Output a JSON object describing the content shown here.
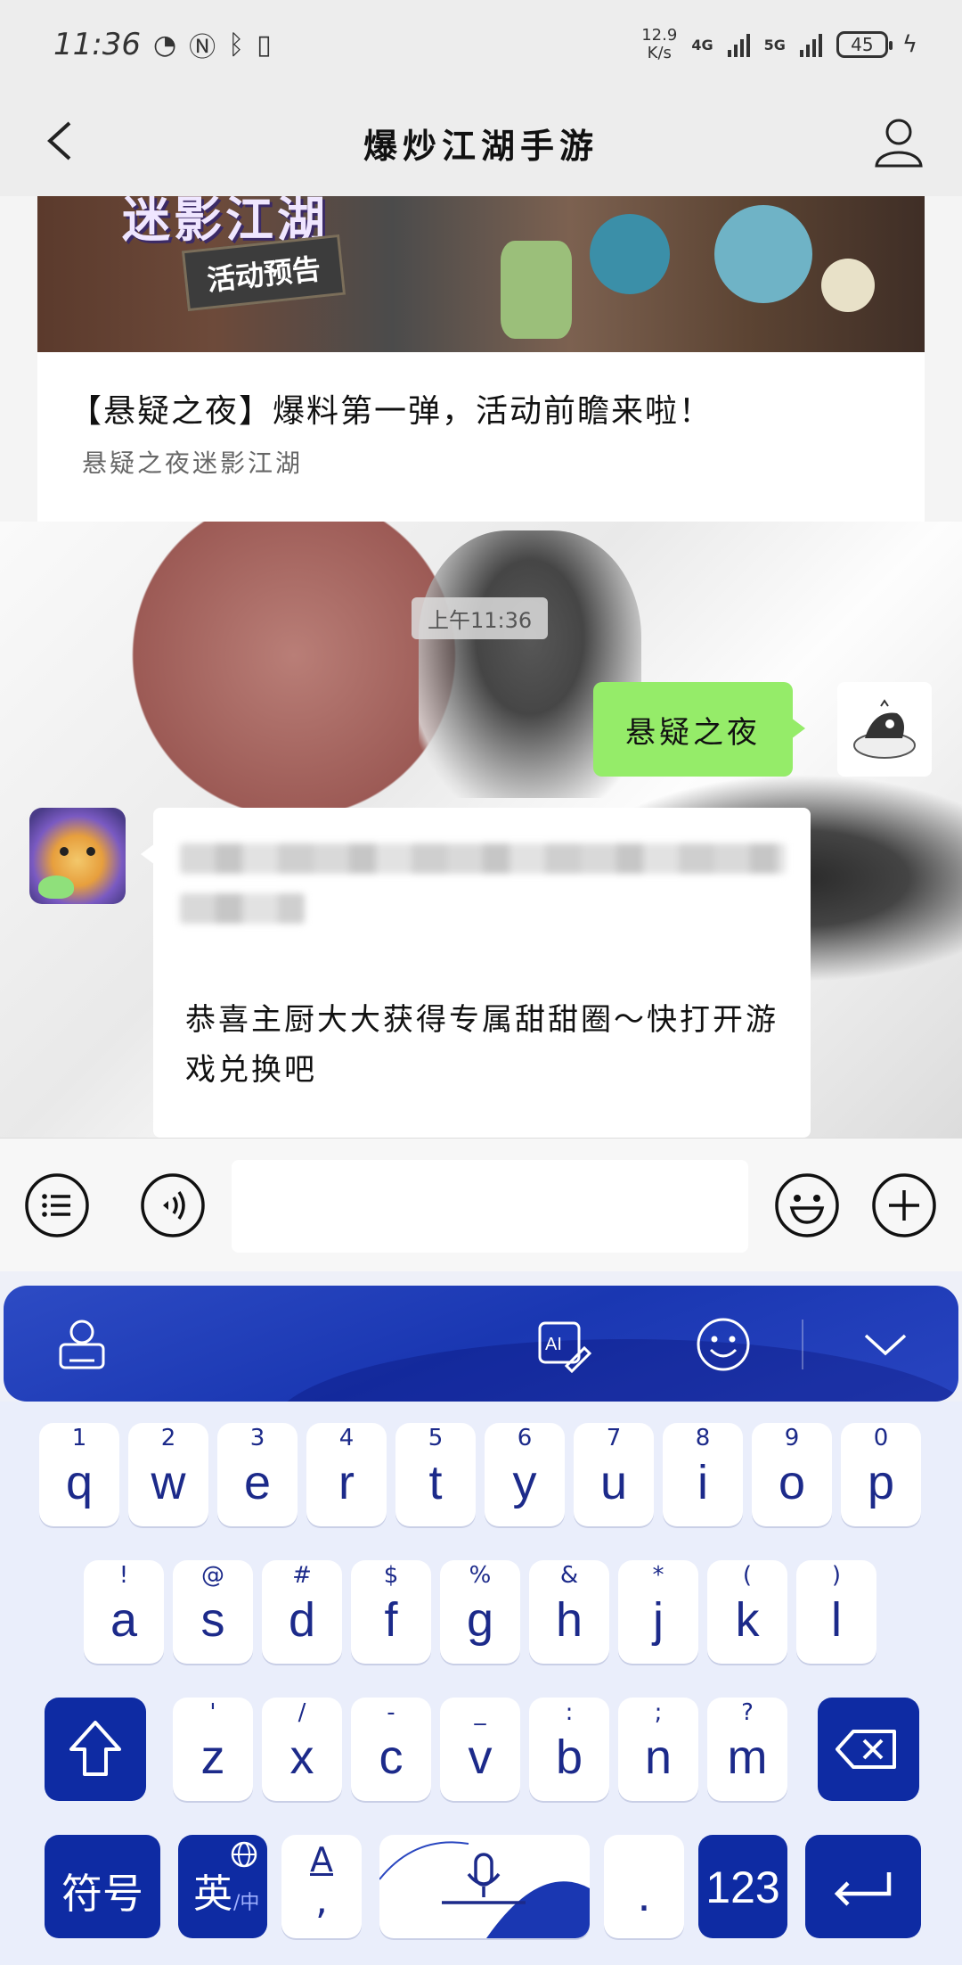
{
  "status_bar": {
    "time": "11:36",
    "net_speed_value": "12.9",
    "net_speed_unit": "K/s",
    "net_type_1": "4G",
    "net_type_2": "5G",
    "battery": "45"
  },
  "header": {
    "title": "爆炒江湖手游"
  },
  "article": {
    "banner_title": "迷影江湖",
    "banner_subtitle": "活动预告",
    "headline": "【悬疑之夜】爆料第一弹，活动前瞻来啦！",
    "source": "悬疑之夜迷影江湖"
  },
  "chat": {
    "timestamp": "上午11:36",
    "outgoing_message": "悬疑之夜",
    "incoming_message": "恭喜主厨大大获得专属甜甜圈～快打开游戏兑换吧"
  },
  "input_bar": {
    "placeholder": ""
  },
  "keyboard": {
    "row1": [
      {
        "num": "1",
        "ch": "q"
      },
      {
        "num": "2",
        "ch": "w"
      },
      {
        "num": "3",
        "ch": "e"
      },
      {
        "num": "4",
        "ch": "r"
      },
      {
        "num": "5",
        "ch": "t"
      },
      {
        "num": "6",
        "ch": "y"
      },
      {
        "num": "7",
        "ch": "u"
      },
      {
        "num": "8",
        "ch": "i"
      },
      {
        "num": "9",
        "ch": "o"
      },
      {
        "num": "0",
        "ch": "p"
      }
    ],
    "row2": [
      {
        "num": "!",
        "ch": "a"
      },
      {
        "num": "@",
        "ch": "s"
      },
      {
        "num": "#",
        "ch": "d"
      },
      {
        "num": "$",
        "ch": "f"
      },
      {
        "num": "%",
        "ch": "g"
      },
      {
        "num": "&",
        "ch": "h"
      },
      {
        "num": "*",
        "ch": "j"
      },
      {
        "num": "(",
        "ch": "k"
      },
      {
        "num": ")",
        "ch": "l"
      }
    ],
    "row3": [
      {
        "num": "'",
        "ch": "z"
      },
      {
        "num": "/",
        "ch": "x"
      },
      {
        "num": "-",
        "ch": "c"
      },
      {
        "num": "_",
        "ch": "v"
      },
      {
        "num": ":",
        "ch": "b"
      },
      {
        "num": ";",
        "ch": "n"
      },
      {
        "num": "?",
        "ch": "m"
      }
    ],
    "symbols_label": "符号",
    "lang_label": "英",
    "lang_sub": "/中",
    "punct_top": "A",
    "punct_bottom": ",",
    "period": ".",
    "numbers_label": "123"
  },
  "colors": {
    "keyboard_accent": "#0e2ba3",
    "bubble_out": "#95ec69",
    "key_text": "#1c2a8a"
  }
}
